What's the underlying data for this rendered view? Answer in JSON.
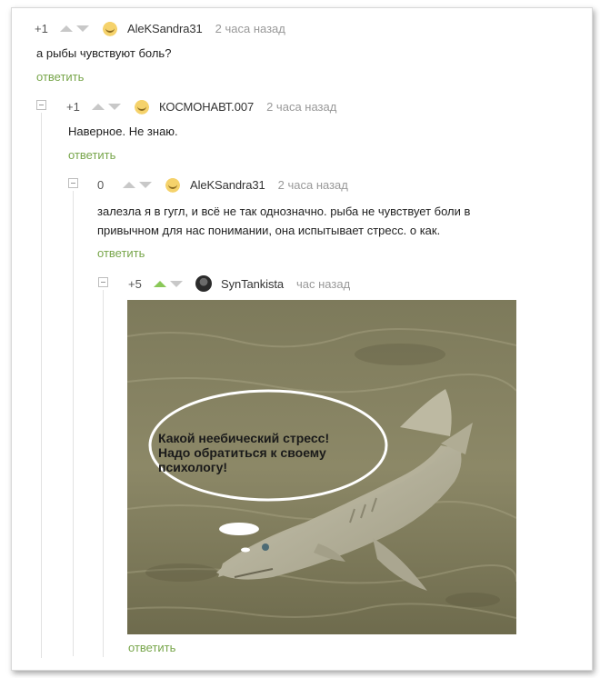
{
  "comments": [
    {
      "rating": "+1",
      "username": "AleKSandra31",
      "time": "2 часа назад",
      "text": "а рыбы чувствуют боль?",
      "reply": "ответить"
    },
    {
      "rating": "+1",
      "username": "КОСМОНАВТ.007",
      "time": "2 часа назад",
      "text": "Наверное. Не знаю.",
      "reply": "ответить"
    },
    {
      "rating": "0",
      "username": "AleKSandra31",
      "time": "2 часа назад",
      "text_line1": "залезла я в гугл, и всё не так однозначно. рыба не чувствует боли в",
      "text_line2": "привычном для нас понимании, она испытывает стресс. о как.",
      "reply": "ответить"
    },
    {
      "rating": "+5",
      "username": "SynTankista",
      "time": "час назад",
      "image_caption_line1": "Какой неебический стресс!",
      "image_caption_line2": "Надо обратиться к своему",
      "image_caption_line3": "психологу!",
      "reply": "ответить"
    }
  ],
  "colors": {
    "reply_link": "#78a64b",
    "upvote_active": "#8ac858",
    "muted": "#999999"
  }
}
